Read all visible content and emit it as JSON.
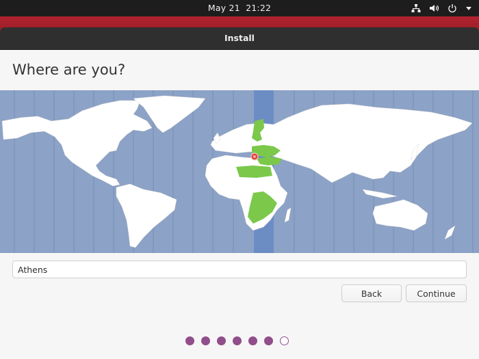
{
  "system_bar": {
    "date": "May 21",
    "time": "21:22",
    "tray_icons": [
      "network-icon",
      "volume-icon",
      "power-icon",
      "dropdown-arrow-icon"
    ]
  },
  "window": {
    "title": "Install"
  },
  "page": {
    "heading": "Where are you?",
    "map": {
      "selected_city": "Athens",
      "highlighted_timezone": "UTC+2",
      "colors": {
        "ocean": "#8ca2c6",
        "land": "#ffffff",
        "selected_zone_band": "#6c8cc4",
        "selected_zone_land": "#7bc84b",
        "pin": "#e0423a"
      }
    },
    "timezone_input": {
      "value": "Athens",
      "placeholder": ""
    },
    "buttons": {
      "back": "Back",
      "continue": "Continue"
    },
    "progress": {
      "total_steps": 7,
      "completed_steps": 6,
      "accent": "#924d8b"
    }
  }
}
